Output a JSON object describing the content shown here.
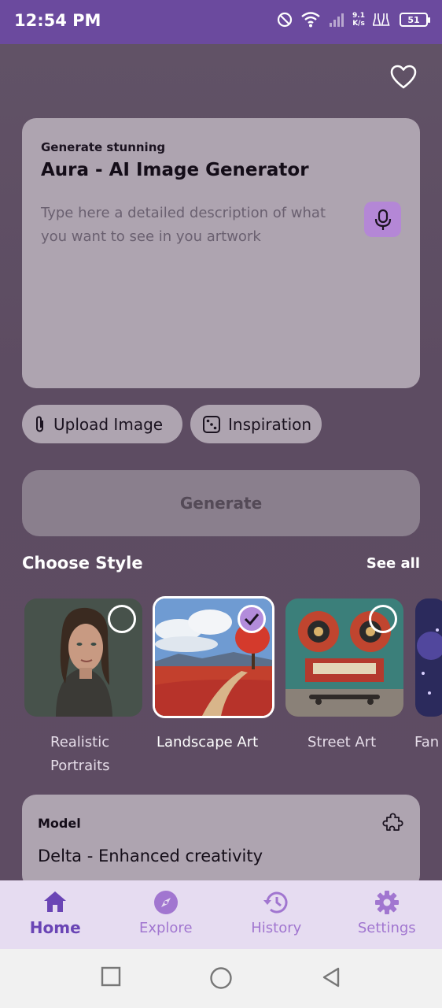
{
  "status_bar": {
    "time": "12:54 PM",
    "net_speed_value": "9.1",
    "net_speed_unit": "K/s",
    "battery": "51"
  },
  "header": {
    "favorite_icon": "heart-outline-icon"
  },
  "prompt": {
    "subtitle": "Generate stunning",
    "title": "Aura - AI Image Generator",
    "placeholder": "Type here a detailed description of what you want to see in you artwork",
    "mic_icon": "microphone-icon"
  },
  "chips": {
    "upload_label": "Upload Image",
    "inspiration_label": "Inspiration"
  },
  "generate_label": "Generate",
  "styles": {
    "section_title": "Choose Style",
    "see_all": "See all",
    "items": [
      {
        "label": "Realistic Portraits",
        "selected": false
      },
      {
        "label": "Landscape Art",
        "selected": true
      },
      {
        "label": "Street Art",
        "selected": false
      },
      {
        "label": "Fan",
        "selected": false
      }
    ]
  },
  "model": {
    "label": "Model",
    "value": "Delta - Enhanced creativity"
  },
  "nav": {
    "items": [
      {
        "label": "Home",
        "icon": "home-icon",
        "active": true
      },
      {
        "label": "Explore",
        "icon": "compass-icon",
        "active": false
      },
      {
        "label": "History",
        "icon": "history-icon",
        "active": false
      },
      {
        "label": "Settings",
        "icon": "gear-icon",
        "active": false
      }
    ]
  },
  "colors": {
    "accent": "#6a45b5",
    "status_bar": "#6b4a9e",
    "nav_bg": "#e6dcf1",
    "card": "#aea4b0",
    "mic": "#b487d6"
  }
}
